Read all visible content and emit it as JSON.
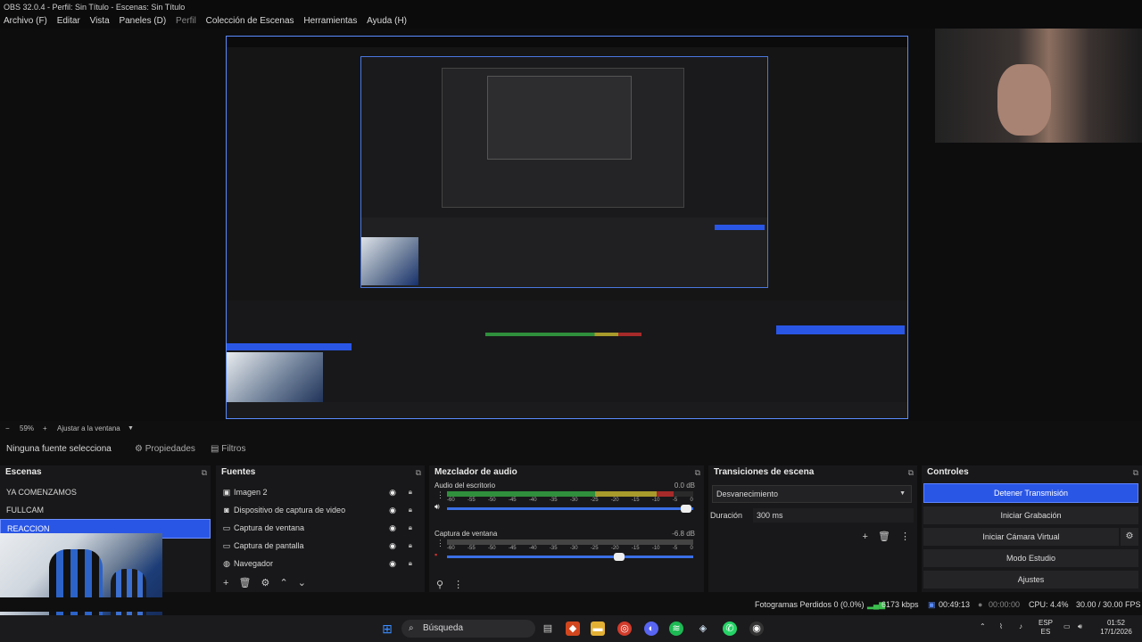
{
  "window": {
    "title": "OBS 32.0.4 - Perfil: Sin Título - Escenas: Sin Título"
  },
  "menu": [
    "Archivo (F)",
    "Editar",
    "Vista",
    "Paneles (D)",
    "Perfil",
    "Colección de Escenas",
    "Herramientas",
    "Ayuda (H)"
  ],
  "scale": {
    "zoom": "59%",
    "fit": "Ajustar a la ventana"
  },
  "source_toolbar": {
    "no_source": "Ninguna fuente selecciona",
    "properties": "Propiedades",
    "filters": "Filtros"
  },
  "scenes": {
    "title": "Escenas",
    "items": [
      "YA COMENZAMOS",
      "FULLCAM",
      "REACCION"
    ],
    "selected": "REACCION"
  },
  "sources": {
    "title": "Fuentes",
    "items": [
      {
        "label": "Imagen 2",
        "icon": "image-icon"
      },
      {
        "label": "Dispositivo de captura de video",
        "icon": "camera-icon"
      },
      {
        "label": "Captura de ventana",
        "icon": "window-icon"
      },
      {
        "label": "Captura de pantalla",
        "icon": "monitor-icon"
      },
      {
        "label": "Navegador",
        "icon": "globe-icon"
      }
    ]
  },
  "mixer": {
    "title": "Mezclador de audio",
    "channels": [
      {
        "name": "Audio del escritorio",
        "db": "0.0 dB",
        "level": 0.92,
        "volume": 0.97
      },
      {
        "name": "Captura de ventana",
        "db": "-6.8 dB",
        "level": 0.0,
        "volume": 0.7
      }
    ],
    "ticks": [
      "-60",
      "-55",
      "-50",
      "-45",
      "-40",
      "-35",
      "-30",
      "-25",
      "-20",
      "-15",
      "-10",
      "-5",
      "0"
    ]
  },
  "transitions": {
    "title": "Transiciones de escena",
    "selected": "Desvanecimiento",
    "duration_label": "Duración",
    "duration_value": "300 ms"
  },
  "controls": {
    "title": "Controles",
    "buttons": [
      "Detener Transmisión",
      "Iniciar Grabación",
      "Iniciar Cámara Virtual",
      "Modo Estudio",
      "Ajustes"
    ]
  },
  "status": {
    "dropped": "Fotogramas Perdidos 0 (0.0%)",
    "bitrate": "6173 kbps",
    "stream_time": "00:49:13",
    "rec_time": "00:00:00",
    "cpu": "CPU: 4.4%",
    "fps": "30.00 / 30.00 FPS"
  },
  "taskbar": {
    "search": "Búsqueda",
    "lang_top": "ESP",
    "lang_bottom": "ES",
    "time": "01:52",
    "date": "17/1/2026"
  },
  "colors": {
    "accent": "#2a56e6",
    "meter_green": "#2f8f3c",
    "meter_yellow": "#a89a2b",
    "meter_red": "#a62a2a"
  }
}
